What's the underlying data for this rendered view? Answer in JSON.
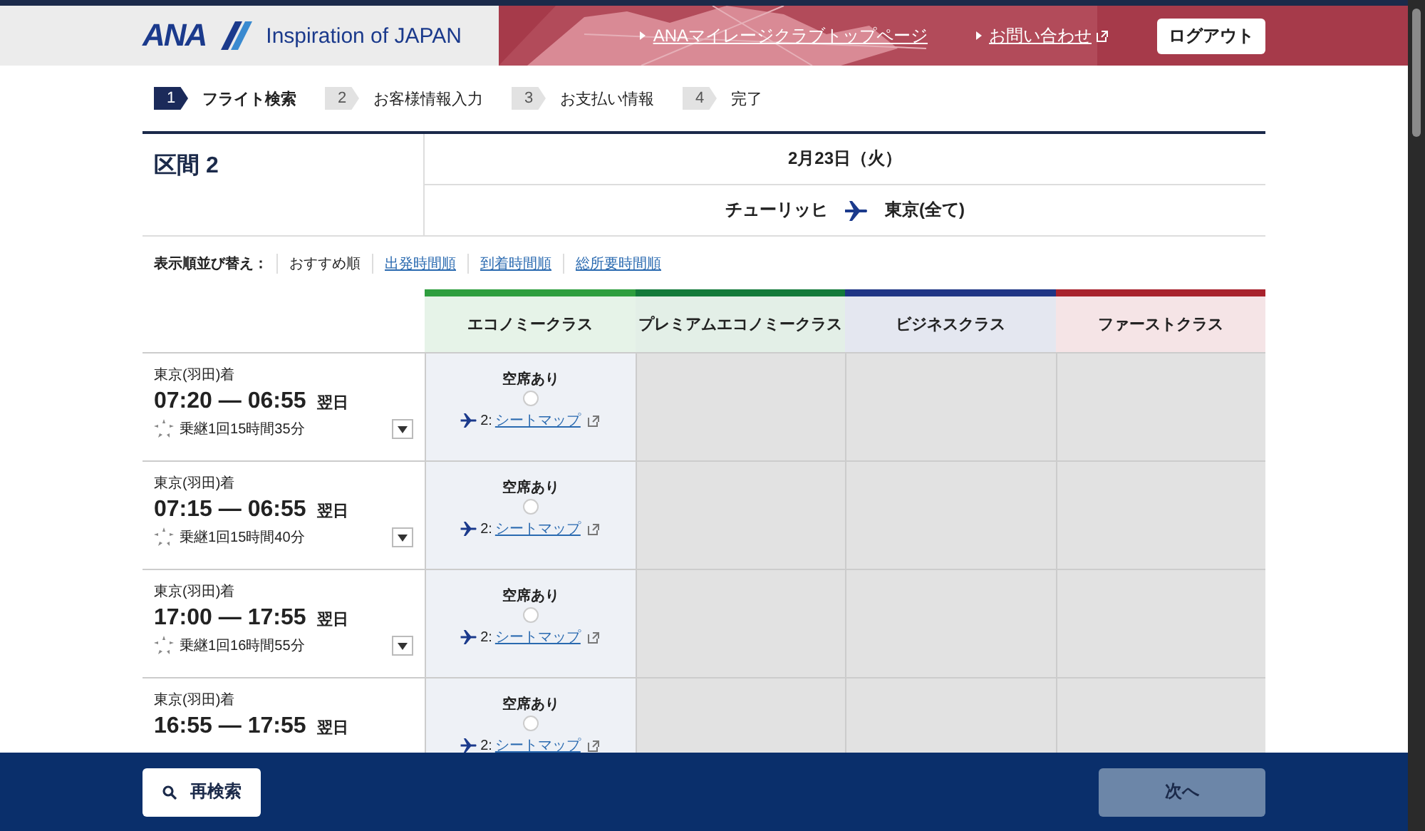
{
  "header": {
    "logo": "ANA",
    "tagline": "Inspiration of JAPAN",
    "links": [
      {
        "label": "ANAマイレージクラブトップページ",
        "external": false
      },
      {
        "label": "お問い合わせ",
        "external": true
      }
    ],
    "logout": "ログアウト"
  },
  "steps": [
    {
      "number": "1",
      "label": "フライト検索",
      "selected": true
    },
    {
      "number": "2",
      "label": "お客様情報入力",
      "selected": false
    },
    {
      "number": "3",
      "label": "お支払い情報",
      "selected": false
    },
    {
      "number": "4",
      "label": "完了",
      "selected": false
    }
  ],
  "segment": {
    "title": "区間 2",
    "date": "2月23日（火）",
    "from": "チューリッヒ",
    "to": "東京(全て)"
  },
  "sort": {
    "label": "表示順並び替え：",
    "options": [
      {
        "label": "おすすめ順",
        "selected": true
      },
      {
        "label": "出発時間順",
        "selected": false
      },
      {
        "label": "到着時間順",
        "selected": false
      },
      {
        "label": "総所要時間順",
        "selected": false
      }
    ]
  },
  "classes": [
    {
      "label": "エコノミークラス",
      "color": "#2e9e3e"
    },
    {
      "label": "プレミアムエコノミークラス",
      "color": "#137a3a"
    },
    {
      "label": "ビジネスクラス",
      "color": "#1f3585"
    },
    {
      "label": "ファーストクラス",
      "color": "#a8222c"
    }
  ],
  "flights": [
    {
      "arrival": "東京(羽田)着",
      "time": "07:20 — 06:55",
      "next_day": "翌日",
      "transfer": "乗継1回15時間35分",
      "fares": [
        {
          "kind": "available",
          "status": "空席あり",
          "selected": false,
          "seats": "2:",
          "seatmap": "シートマップ"
        },
        {
          "kind": "none"
        },
        {
          "kind": "none"
        },
        {
          "kind": "none"
        }
      ]
    },
    {
      "arrival": "東京(羽田)着",
      "time": "07:15 — 06:55",
      "next_day": "翌日",
      "transfer": "乗継1回15時間40分",
      "fares": [
        {
          "kind": "available",
          "status": "空席あり",
          "selected": false,
          "seats": "2:",
          "seatmap": "シートマップ"
        },
        {
          "kind": "none"
        },
        {
          "kind": "none"
        },
        {
          "kind": "none"
        }
      ]
    },
    {
      "arrival": "東京(羽田)着",
      "time": "17:00 — 17:55",
      "next_day": "翌日",
      "transfer": "乗継1回16時間55分",
      "fares": [
        {
          "kind": "available",
          "status": "空席あり",
          "selected": false,
          "seats": "2:",
          "seatmap": "シートマップ"
        },
        {
          "kind": "none"
        },
        {
          "kind": "none"
        },
        {
          "kind": "none"
        }
      ]
    },
    {
      "arrival": "東京(羽田)着",
      "time": "16:55 — 17:55",
      "next_day": "翌日",
      "fares": [
        {
          "kind": "available",
          "status": "空席あり",
          "selected": false,
          "seats": "2:",
          "seatmap": "シートマップ"
        },
        {
          "kind": "none"
        },
        {
          "kind": "none"
        },
        {
          "kind": "none"
        }
      ]
    }
  ],
  "footer": {
    "research": "再検索",
    "next": {
      "label": "次へ",
      "disabled": true
    }
  }
}
